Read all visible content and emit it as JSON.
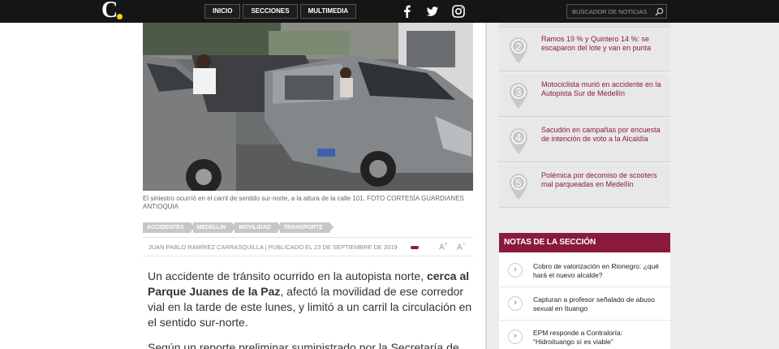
{
  "header": {
    "nav": [
      "INICIO",
      "SECCIONES",
      "MULTIMEDIA"
    ],
    "search_placeholder": "BUSCADOR DE NOTICIAS",
    "brand_colors": {
      "bar": "#151515",
      "logo_dot": "#f5d20a"
    }
  },
  "article": {
    "caption": "El siniestro ocurrió en el carril de sentido sur-norte, a la altura de la calle 101. FOTO CORTESÍA GUARDIANES ANTIOQUIA",
    "tags": [
      "ACCIDENTES",
      "MEDELLÍN",
      "MOVILIDAD",
      "TRANSPORTE"
    ],
    "byline": "JUAN PABLO RAMÍREZ CARRASQUILLA | PUBLICADO EL 23 DE SEPTIEMBRE DE 2019",
    "font_up": "A",
    "font_down": "A",
    "font_up_sign": "+",
    "font_down_sign": "−",
    "p1_a": "Un accidente de tránsito ocurrido en la autopista norte, ",
    "p1_b": "cerca al Parque Juanes de la Paz",
    "p1_c": ", afectó la movilidad de ese corredor vial en la tarde de este lunes, y limitó a un carril la circulación en el sentido sur-norte.",
    "p2": "Según un reporte preliminar suministrado por la Secretaría de"
  },
  "related": [
    {
      "num": "2",
      "text": "Ramos 19 % y Quintero 14 %: se escaparon del lote y van en punta"
    },
    {
      "num": "3",
      "text": "Motociclista murió en accidente en la Autopista Sur de Medellín"
    },
    {
      "num": "4",
      "text": "Sacudón en campañas por encuesta de intención de voto a la Alcaldía"
    },
    {
      "num": "5",
      "text": "Polémica por decomiso de scooters mal parqueadas en Medellín"
    }
  ],
  "notas": {
    "title": "NOTAS DE LA SECCIÓN",
    "arrow": "›",
    "items": [
      "Cobro de valorización en Rionegro: ¿qué hará el nuevo alcalde?",
      "Capturan a profesor señalado de abuso sexual en Ituango",
      "EPM responde a Contraloría: “Hidroituango sí es viable”"
    ]
  },
  "colors": {
    "accent": "#8a1a3c",
    "related_text": "#8c1a3d"
  }
}
